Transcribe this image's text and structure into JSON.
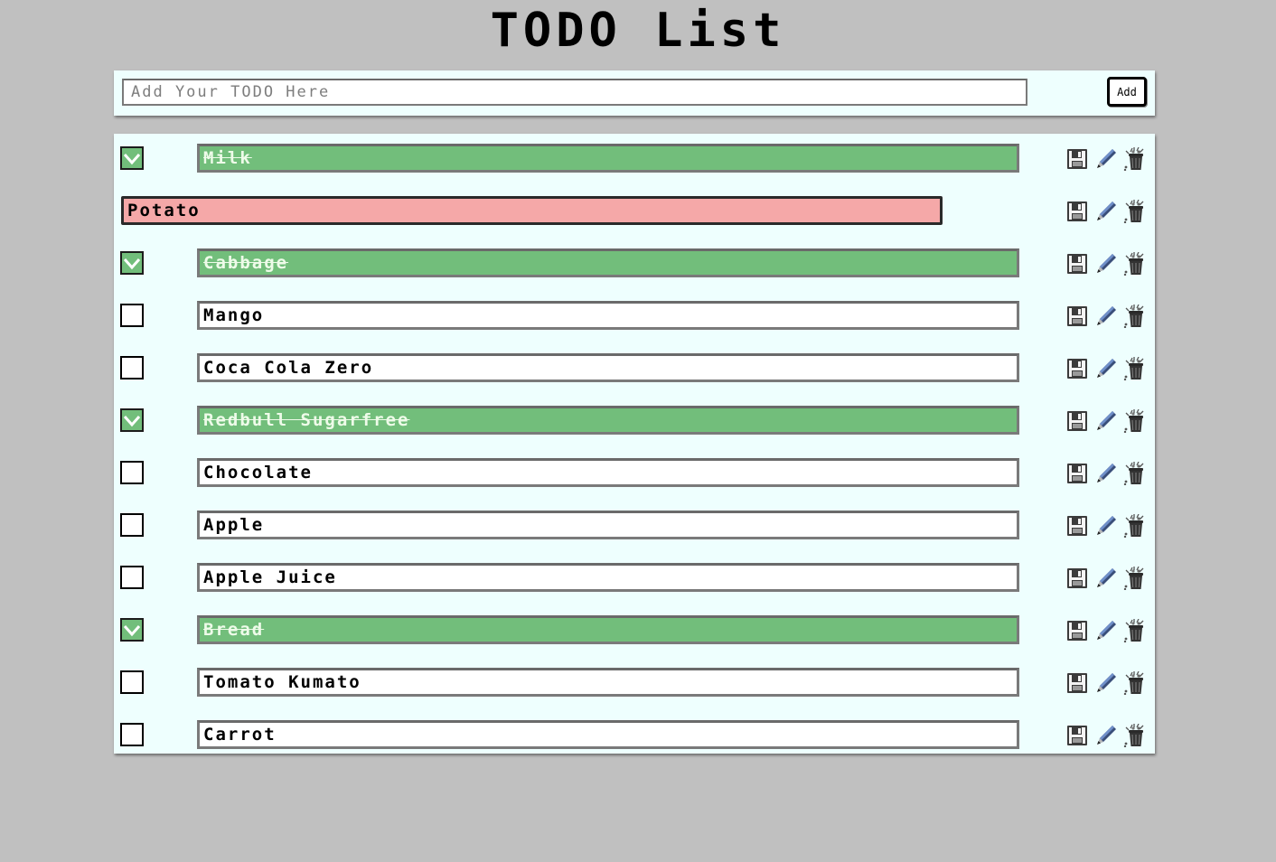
{
  "app": {
    "title": "TODO List"
  },
  "add_form": {
    "placeholder": "Add Your TODO Here",
    "value": "",
    "button_label": "Add"
  },
  "colors": {
    "background": "#c0c0c0",
    "panel": "#eefffe",
    "done": "#72be7b",
    "editing": "#f5a8a8"
  },
  "todos": [
    {
      "text": "Milk",
      "done": true,
      "editing": false
    },
    {
      "text": "Potato",
      "done": false,
      "editing": true
    },
    {
      "text": "Cabbage",
      "done": true,
      "editing": false
    },
    {
      "text": "Mango",
      "done": false,
      "editing": false
    },
    {
      "text": "Coca Cola Zero",
      "done": false,
      "editing": false
    },
    {
      "text": "Redbull Sugarfree",
      "done": true,
      "editing": false
    },
    {
      "text": "Chocolate",
      "done": false,
      "editing": false
    },
    {
      "text": "Apple",
      "done": false,
      "editing": false
    },
    {
      "text": "Apple Juice",
      "done": false,
      "editing": false
    },
    {
      "text": "Bread",
      "done": true,
      "editing": false
    },
    {
      "text": "Tomato Kumato",
      "done": false,
      "editing": false
    },
    {
      "text": "Carrot",
      "done": false,
      "editing": false
    }
  ],
  "row_icons": [
    "floppy-disk-icon",
    "pencil-icon",
    "trash-can-icon"
  ]
}
